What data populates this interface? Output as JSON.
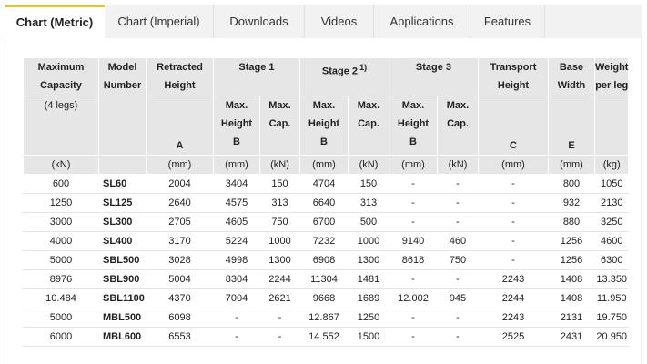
{
  "tabs": [
    {
      "label": "Chart (Metric)",
      "active": true
    },
    {
      "label": "Chart (Imperial)",
      "active": false
    },
    {
      "label": "Downloads",
      "active": false
    },
    {
      "label": "Videos",
      "active": false
    },
    {
      "label": "Applications",
      "active": false
    },
    {
      "label": "Features",
      "active": false
    }
  ],
  "accent_color": "#f5c400",
  "table": {
    "headers": {
      "capacity": "Maximum Capacity",
      "capacity_note": "(4 legs)",
      "model": "Model Number",
      "retracted": "Retracted Height",
      "stage1": "Stage 1",
      "stage2": "Stage 2",
      "stage2_sup": "1)",
      "stage3": "Stage 3",
      "transport": "Transport Height",
      "base": "Base Width",
      "weight": "Weight per leg",
      "max_height": "Max. Height",
      "max_cap": "Max. Cap.",
      "letter_a": "A",
      "letter_b": "B",
      "letter_c": "C",
      "letter_e": "E"
    },
    "units": [
      "(kN)",
      "",
      "(mm)",
      "(mm)",
      "(kN)",
      "(mm)",
      "(kN)",
      "(mm)",
      "(kN)",
      "(mm)",
      "(mm)",
      "(kg)"
    ],
    "rows": [
      [
        "600",
        "SL60",
        "2004",
        "3404",
        "150",
        "4704",
        "150",
        "-",
        "-",
        "-",
        "800",
        "1050"
      ],
      [
        "1250",
        "SL125",
        "2640",
        "4575",
        "313",
        "6640",
        "313",
        "-",
        "-",
        "-",
        "932",
        "2130"
      ],
      [
        "3000",
        "SL300",
        "2705",
        "4605",
        "750",
        "6700",
        "500",
        "-",
        "-",
        "-",
        "880",
        "3250"
      ],
      [
        "4000",
        "SL400",
        "3170",
        "5224",
        "1000",
        "7232",
        "1000",
        "9140",
        "460",
        "-",
        "1256",
        "4600"
      ],
      [
        "5000",
        "SBL500",
        "3028",
        "4998",
        "1300",
        "6908",
        "1300",
        "8618",
        "750",
        "-",
        "1256",
        "6300"
      ],
      [
        "8976",
        "SBL900",
        "5004",
        "8304",
        "2244",
        "11304",
        "1481",
        "-",
        "-",
        "2243",
        "1408",
        "13.350"
      ],
      [
        "10.484",
        "SBL1100",
        "4370",
        "7004",
        "2621",
        "9668",
        "1689",
        "12.002",
        "945",
        "2244",
        "1408",
        "11.950"
      ],
      [
        "5000",
        "MBL500",
        "6098",
        "-",
        "-",
        "12.867",
        "1250",
        "-",
        "-",
        "2243",
        "2131",
        "19.750"
      ],
      [
        "6000",
        "MBL600",
        "6553",
        "-",
        "-",
        "14.552",
        "1500",
        "-",
        "-",
        "2525",
        "2431",
        "20.950"
      ]
    ]
  }
}
